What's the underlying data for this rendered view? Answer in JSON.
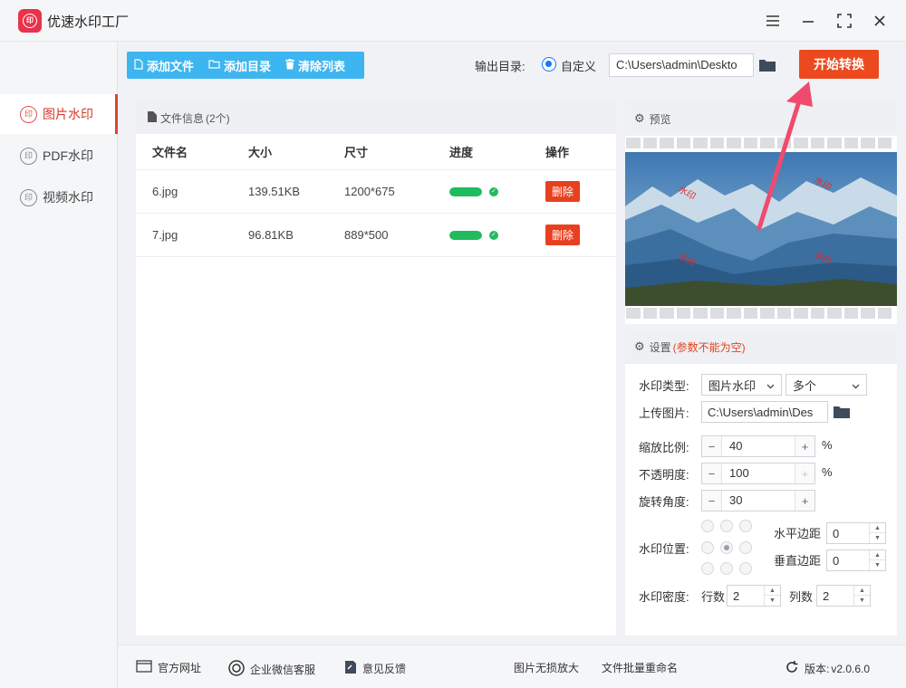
{
  "app": {
    "title": "优速水印工厂"
  },
  "sidebar": {
    "items": [
      {
        "label": "图片水印",
        "active": true
      },
      {
        "label": "PDF水印",
        "active": false
      },
      {
        "label": "视频水印",
        "active": false
      }
    ]
  },
  "toolbar": {
    "add_file": "添加文件",
    "add_folder": "添加目录",
    "clear_list": "清除列表",
    "output_label": "输出目录:",
    "output_mode": "自定义",
    "output_path": "C:\\Users\\admin\\Deskto",
    "start": "开始转换"
  },
  "file_panel": {
    "title": "文件信息",
    "count": "(2个)",
    "columns": [
      "文件名",
      "大小",
      "尺寸",
      "进度",
      "操作"
    ],
    "rows": [
      {
        "name": "6.jpg",
        "size": "139.51KB",
        "dims": "1200*675",
        "progress": 1.0,
        "action": "删除"
      },
      {
        "name": "7.jpg",
        "size": "96.81KB",
        "dims": "889*500",
        "progress": 1.0,
        "action": "删除"
      }
    ]
  },
  "preview": {
    "title": "预览",
    "watermark_text": "水印"
  },
  "settings": {
    "title": "设置",
    "note": "(参数不能为空)",
    "type_label": "水印类型:",
    "type_value": "图片水印",
    "count_value": "多个",
    "upload_label": "上传图片:",
    "upload_path": "C:\\Users\\admin\\Des",
    "scale_label": "缩放比例:",
    "scale_value": "40",
    "opacity_label": "不透明度:",
    "opacity_value": "100",
    "rotate_label": "旋转角度:",
    "rotate_value": "30",
    "percent": "%",
    "position_label": "水印位置:",
    "h_margin_label": "水平边距",
    "h_margin_value": "0",
    "v_margin_label": "垂直边距",
    "v_margin_value": "0",
    "density_label": "水印密度:",
    "rows_label": "行数",
    "rows_value": "2",
    "cols_label": "列数",
    "cols_value": "2"
  },
  "footer": {
    "website": "官方网址",
    "wechat": "企业微信客服",
    "feedback": "意见反馈",
    "enlarge": "图片无损放大",
    "rename": "文件批量重命名",
    "version_label": "版本:",
    "version": "v2.0.6.0"
  },
  "colors": {
    "accent": "#ec4a1e",
    "toolbar": "#3db5f0",
    "progress": "#1fbb5e",
    "active_nav": "#d9362b"
  },
  "icons": [
    "app-logo",
    "menu-icon",
    "minimize-icon",
    "maximize-icon",
    "close-icon",
    "folder-icon",
    "gear-icon",
    "refresh-icon"
  ]
}
